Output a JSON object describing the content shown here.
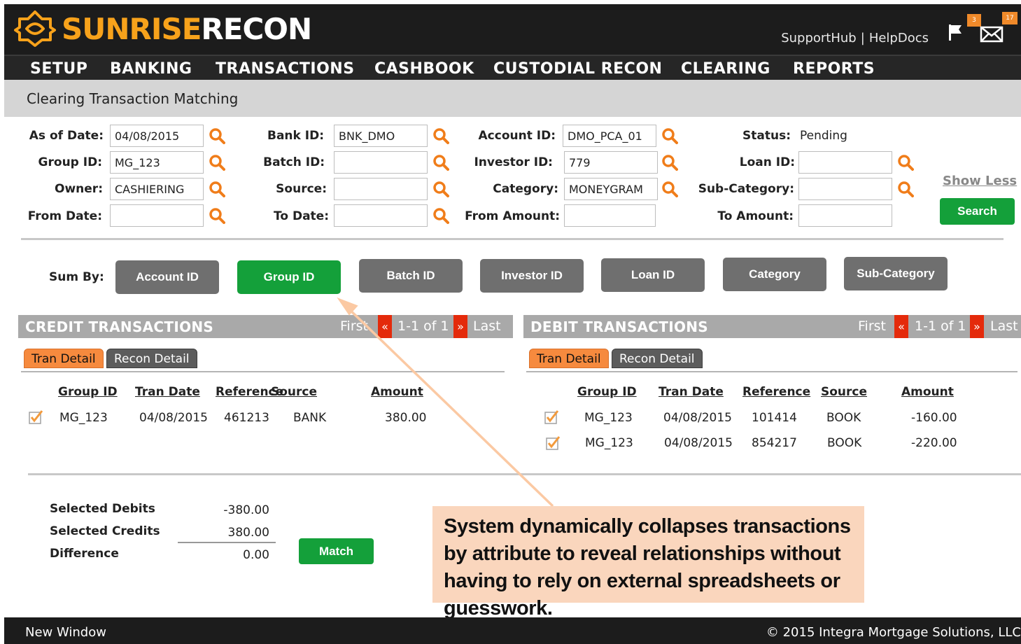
{
  "header": {
    "logo_sun": "SUNRISE",
    "logo_recon": "RECON",
    "links": [
      "SupportHub",
      "HelpDocs"
    ],
    "link_separator": "|",
    "flag_badge": "3",
    "mail_badge": "17",
    "brand_color": "#f7a21b"
  },
  "nav": {
    "items": [
      "SETUP",
      "BANKING",
      "TRANSACTIONS",
      "CASHBOOK",
      "CUSTODIAL RECON",
      "CLEARING",
      "REPORTS"
    ]
  },
  "page_title": "Clearing Transaction Matching",
  "filters": {
    "as_of_date": {
      "label": "As of Date:",
      "value": "04/08/2015"
    },
    "group_id": {
      "label": "Group ID:",
      "value": "MG_123"
    },
    "owner": {
      "label": "Owner:",
      "value": "CASHIERING"
    },
    "from_date": {
      "label": "From Date:",
      "value": ""
    },
    "bank_id": {
      "label": "Bank ID:",
      "value": "BNK_DMO"
    },
    "batch_id": {
      "label": "Batch ID:",
      "value": ""
    },
    "source": {
      "label": "Source:",
      "value": ""
    },
    "to_date": {
      "label": "To Date:",
      "value": ""
    },
    "account_id": {
      "label": "Account ID:",
      "value": "DMO_PCA_01"
    },
    "investor_id": {
      "label": "Investor ID:",
      "value": "779"
    },
    "category": {
      "label": "Category:",
      "value": "MONEYGRAM"
    },
    "from_amount": {
      "label": "From Amount:",
      "value": ""
    },
    "status": {
      "label": "Status:",
      "value": "Pending"
    },
    "loan_id": {
      "label": "Loan ID:",
      "value": ""
    },
    "sub_category": {
      "label": "Sub-Category:",
      "value": ""
    },
    "to_amount": {
      "label": "To Amount:",
      "value": ""
    },
    "show_less": "Show Less",
    "search": "Search"
  },
  "sum_by": {
    "label": "Sum By:",
    "options": [
      "Account ID",
      "Group ID",
      "Batch ID",
      "Investor ID",
      "Loan ID",
      "Category",
      "Sub-Category"
    ],
    "selected": "Group ID"
  },
  "credit": {
    "title": "CREDIT TRANSACTIONS",
    "pager": {
      "first": "First",
      "prev": "«",
      "range": "1-1 of 1",
      "next": "»",
      "last": "Last"
    },
    "tabs": [
      "Tran Detail",
      "Recon Detail"
    ],
    "columns": [
      "Group ID",
      "Tran Date",
      "Reference",
      "Source",
      "Amount"
    ],
    "rows": [
      {
        "checked": true,
        "group_id": "MG_123",
        "tran_date": "04/08/2015",
        "reference": "461213",
        "source": "BANK",
        "amount": "380.00"
      }
    ]
  },
  "debit": {
    "title": "DEBIT TRANSACTIONS",
    "pager": {
      "first": "First",
      "prev": "«",
      "range": "1-1 of 1",
      "next": "»",
      "last": "Last"
    },
    "tabs": [
      "Tran Detail",
      "Recon Detail"
    ],
    "columns": [
      "Group ID",
      "Tran Date",
      "Reference",
      "Source",
      "Amount"
    ],
    "rows": [
      {
        "checked": true,
        "group_id": "MG_123",
        "tran_date": "04/08/2015",
        "reference": "101414",
        "source": "BOOK",
        "amount": "-160.00"
      },
      {
        "checked": true,
        "group_id": "MG_123",
        "tran_date": "04/08/2015",
        "reference": "854217",
        "source": "BOOK",
        "amount": "-220.00"
      }
    ]
  },
  "totals": {
    "selected_debits": {
      "label": "Selected Debits",
      "value": "-380.00"
    },
    "selected_credits": {
      "label": "Selected Credits",
      "value": "380.00"
    },
    "difference": {
      "label": "Difference",
      "value": "0.00"
    },
    "match": "Match"
  },
  "callout": {
    "text": "System dynamically collapses transactions by attribute to reveal relationships without having to rely on external spreadsheets or guesswork."
  },
  "footer": {
    "new_window": "New Window",
    "copyright": "© 2015  Integra Mortgage Solutions, LLC"
  }
}
